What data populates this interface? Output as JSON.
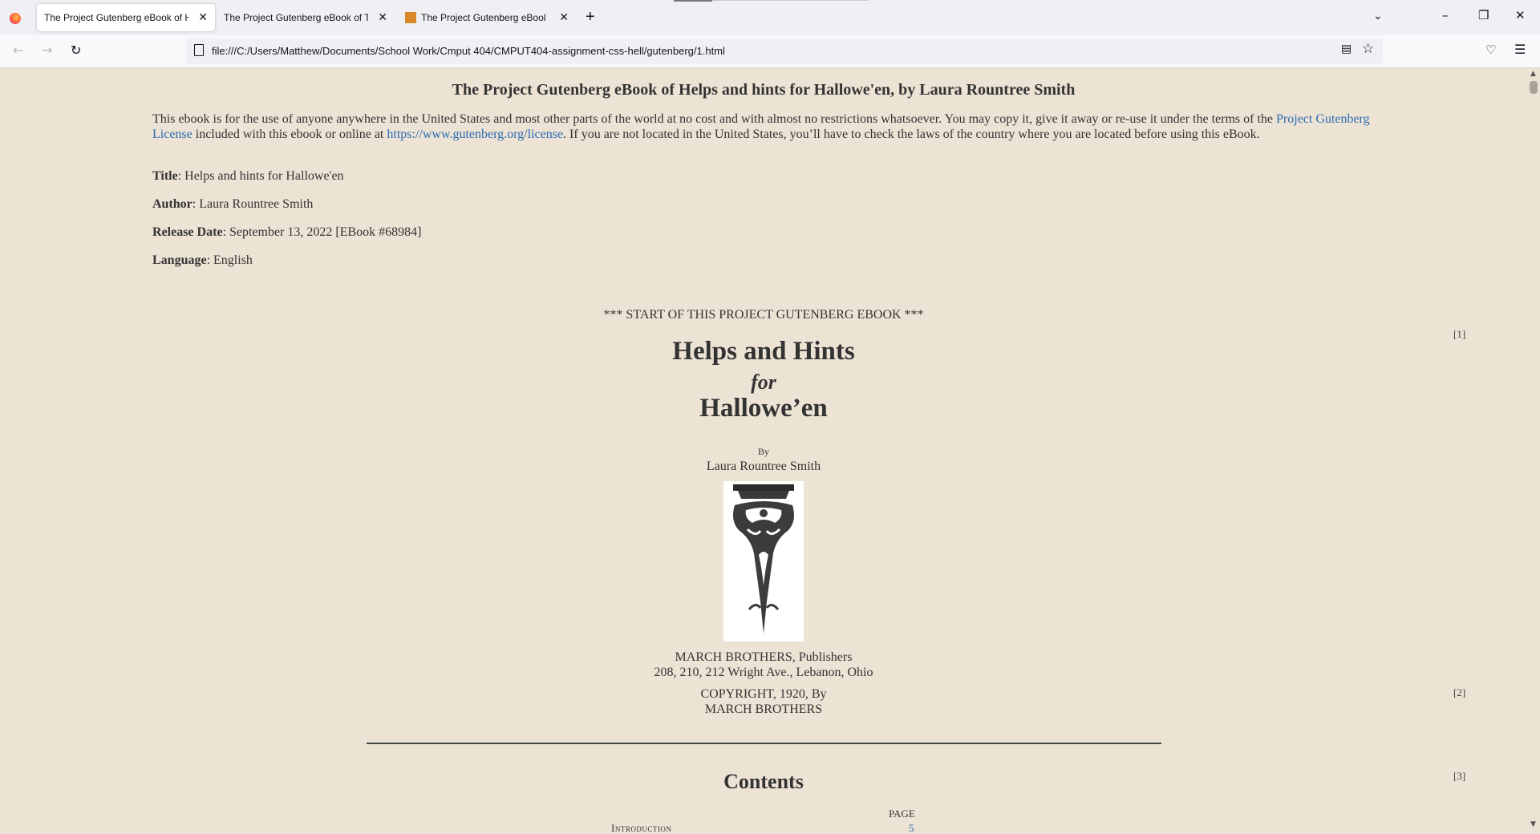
{
  "browser": {
    "tabs": [
      {
        "title": "The Project Gutenberg eBook of Helps and hints for Hallowe'en"
      },
      {
        "title": "The Project Gutenberg eBook of The"
      },
      {
        "title": "The Project Gutenberg eBook of"
      }
    ],
    "close_glyph": "✕",
    "new_tab_glyph": "+",
    "url": "file:///C:/Users/Matthew/Documents/School Work/Cmput 404/CMPUT404-assignment-css-hell/gutenberg/1.html",
    "icons": {
      "back": "arrow-left-icon",
      "forward": "arrow-right-icon",
      "reload": "reload-icon",
      "page": "page-icon",
      "reader": "reader-view-icon",
      "bookmark": "star-icon",
      "pocket": "pocket-icon",
      "menu": "hamburger-menu-icon",
      "tab_list": "chevron-down-icon"
    }
  },
  "page": {
    "heading": "The Project Gutenberg eBook of Helps and hints for Hallowe'en, by Laura Rountree Smith",
    "intro_before": "This ebook is for the use of anyone anywhere in the United States and most other parts of the world at no cost and with almost no restrictions whatsoever. You may copy it, give it away or re-use it under the terms of the ",
    "license_link": "Project Gutenberg License",
    "intro_middle": " included with this ebook or online at ",
    "license_url": "https://www.gutenberg.org/license",
    "intro_after": ". If you are not located in the United States, you’ll have to check the laws of the country where you are located before using this eBook.",
    "meta": {
      "title_label": "Title",
      "title_value": ": Helps and hints for Hallowe'en",
      "author_label": "Author",
      "author_value": ": Laura Rountree Smith",
      "release_label": "Release Date",
      "release_value": ": September 13, 2022 [EBook #68984]",
      "language_label": "Language",
      "language_value": ": English"
    },
    "start_marker": "*** START OF THIS PROJECT GUTENBERG EBOOK ***",
    "page_numbers": [
      "[1]",
      "[2]",
      "[3]"
    ],
    "book_title_line1": "Helps and Hints",
    "book_title_line2": "for",
    "book_title_line3": "Hallowe’en",
    "by": "By",
    "author": "Laura Rountree Smith",
    "publisher_line1": "MARCH BROTHERS, Publishers",
    "publisher_line2": "208, 210, 212 Wright Ave., Lebanon, Ohio",
    "copyright_line1": "COPYRIGHT, 1920, By",
    "copyright_line2": "MARCH BROTHERS",
    "contents_heading": "Contents",
    "contents_page_header": "PAGE",
    "toc": [
      {
        "label": "Introduction",
        "page": "5"
      }
    ]
  }
}
